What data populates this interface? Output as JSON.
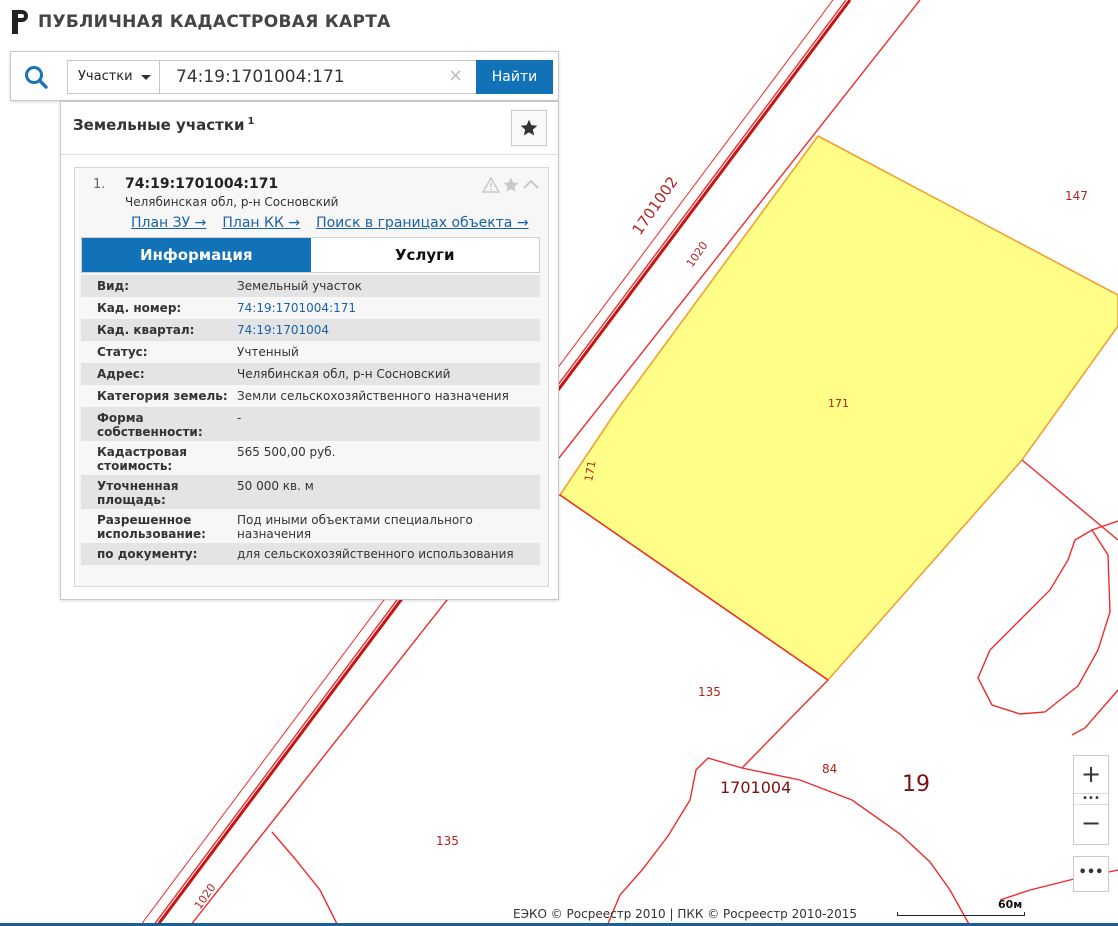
{
  "app": {
    "title": "ПУБЛИЧНАЯ КАДАСТРОВАЯ КАРТА"
  },
  "search": {
    "type_label": "Участки",
    "query": "74:19:1701004:171",
    "clear_glyph": "×",
    "find_label": "Найти"
  },
  "results": {
    "title": "Земельные участки",
    "count": "1",
    "item": {
      "index": "1.",
      "cad_number": "74:19:1701004:171",
      "address": "Челябинская обл, р-н Сосновский",
      "links": [
        "План ЗУ →",
        "План КК →",
        "Поиск в границах объекта →"
      ],
      "tabs": [
        "Информация",
        "Услуги"
      ],
      "fields": [
        {
          "key": "Вид:",
          "value": "Земельный участок"
        },
        {
          "key": "Кад. номер:",
          "value": "74:19:1701004:171"
        },
        {
          "key": "Кад. квартал:",
          "value": "74:19:1701004"
        },
        {
          "key": "Статус:",
          "value": "Учтенный"
        },
        {
          "key": "Адрес:",
          "value": "Челябинская обл, р-н Сосновский"
        },
        {
          "key": "Категория земель:",
          "value": "Земли сельскохозяйственного назначения"
        },
        {
          "key": "Форма собственности:",
          "value": "-"
        },
        {
          "key": "Кадастровая стоимость:",
          "value": "565 500,00 руб."
        },
        {
          "key": "Уточненная площадь:",
          "value": "50 000 кв. м"
        },
        {
          "key": "Разрешенное использование:",
          "value": "Под иными объектами специального назначения"
        },
        {
          "key": "по документу:",
          "value": "для сельскохозяйственного использования"
        }
      ]
    }
  },
  "map": {
    "labels": {
      "quarter_1701002": "1701002",
      "num_1020_top": "1020",
      "num_147": "147",
      "num_171_center": "171",
      "num_171_edge": "171",
      "num_135_mid": "135",
      "num_84": "84",
      "quarter_1701004": "1701004",
      "num_19": "19",
      "num_135_bottom": "135",
      "num_1020_bottom": "1020"
    },
    "colors": {
      "boundary": "#ee2b2b",
      "parcel_fill": "#ffff88",
      "parcel_edge": "#f0a030",
      "label": "#b52020"
    }
  },
  "controls": {
    "zoom_in": "+",
    "zoom_dots": "•••",
    "zoom_out": "−",
    "more": "•••"
  },
  "footer": {
    "copyright": "ЕЭКО © Росреестр 2010 | ПКК © Росреестр 2010-2015",
    "scale": "60м"
  },
  "icons": [
    "logo-icon",
    "search-icon",
    "chevron-down-icon",
    "close-icon",
    "star-icon",
    "warning-icon",
    "chevron-up-icon"
  ]
}
